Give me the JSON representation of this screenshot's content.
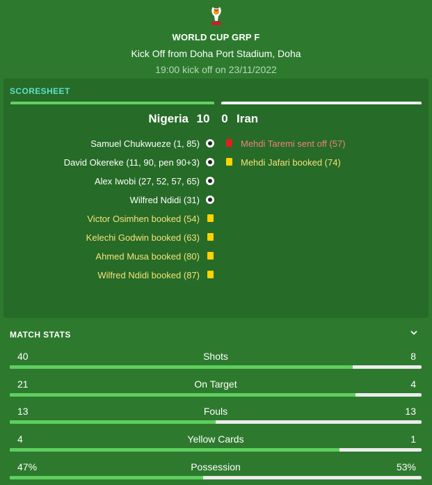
{
  "header": {
    "competition": "WORLD CUP GRP F",
    "venue": "Kick Off from Doha Port Stadium, Doha",
    "kickoff": "19:00 kick off on 23/11/2022",
    "logo_icon": "world-cup-trophy-icon"
  },
  "scoresheet": {
    "title": "SCORESHEET",
    "home_team": "Nigeria",
    "home_score": "10",
    "away_score": "0",
    "away_team": "Iran",
    "home_color": "#62d062",
    "away_color": "#f0f0f0",
    "home_events": [
      {
        "text": "Samuel Chukwueze (1, 85)",
        "type": "goal",
        "icon": "ball-icon"
      },
      {
        "text": "David Okereke (11, 90, pen 90+3)",
        "type": "goal",
        "icon": "ball-icon"
      },
      {
        "text": "Alex Iwobi (27, 52, 57, 65)",
        "type": "goal",
        "icon": "ball-icon"
      },
      {
        "text": "Wilfred Ndidi (31)",
        "type": "goal",
        "icon": "ball-icon"
      },
      {
        "text": "Victor Osimhen booked (54)",
        "type": "yellow",
        "icon": "yellow-card-icon"
      },
      {
        "text": "Kelechi Godwin booked (63)",
        "type": "yellow",
        "icon": "yellow-card-icon"
      },
      {
        "text": "Ahmed Musa booked (80)",
        "type": "yellow",
        "icon": "yellow-card-icon"
      },
      {
        "text": "Wilfred Ndidi booked (87)",
        "type": "yellow",
        "icon": "yellow-card-icon"
      }
    ],
    "away_events": [
      {
        "text": "Mehdi Taremi sent off (57)",
        "type": "red",
        "icon": "red-card-icon"
      },
      {
        "text": "Mehdi Jafari booked (74)",
        "type": "yellow",
        "icon": "yellow-card-icon"
      }
    ]
  },
  "match_stats": {
    "title": "MATCH STATS",
    "toggle_icon": "chevron-down-icon",
    "rows": [
      {
        "label": "Shots",
        "home": "40",
        "away": "8",
        "home_share": 0.833
      },
      {
        "label": "On Target",
        "home": "21",
        "away": "4",
        "home_share": 0.84
      },
      {
        "label": "Fouls",
        "home": "13",
        "away": "13",
        "home_share": 0.5
      },
      {
        "label": "Yellow Cards",
        "home": "4",
        "away": "1",
        "home_share": 0.8
      },
      {
        "label": "Possession",
        "home": "47%",
        "away": "53%",
        "home_share": 0.47
      }
    ]
  }
}
